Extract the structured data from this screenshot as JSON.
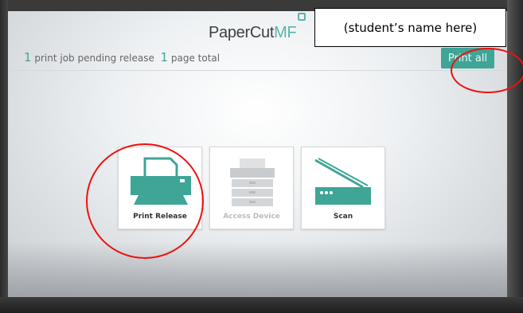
{
  "header": {
    "logo_main": "PaperCut",
    "logo_suffix": "MF",
    "student_name_placeholder": "(student’s name here)"
  },
  "status": {
    "job_count": "1",
    "job_label": "print job pending release",
    "page_count": "1",
    "page_label": "page total"
  },
  "actions": {
    "print_all_label": "Print all"
  },
  "tiles": [
    {
      "label": "Print Release",
      "icon": "printer-icon",
      "enabled": true
    },
    {
      "label": "Access Device",
      "icon": "copier-icon",
      "enabled": false
    },
    {
      "label": "Scan",
      "icon": "scanner-icon",
      "enabled": true
    }
  ],
  "colors": {
    "accent": "#3fa596",
    "annotation": "#e11111",
    "disabled": "#b9bcbf"
  }
}
